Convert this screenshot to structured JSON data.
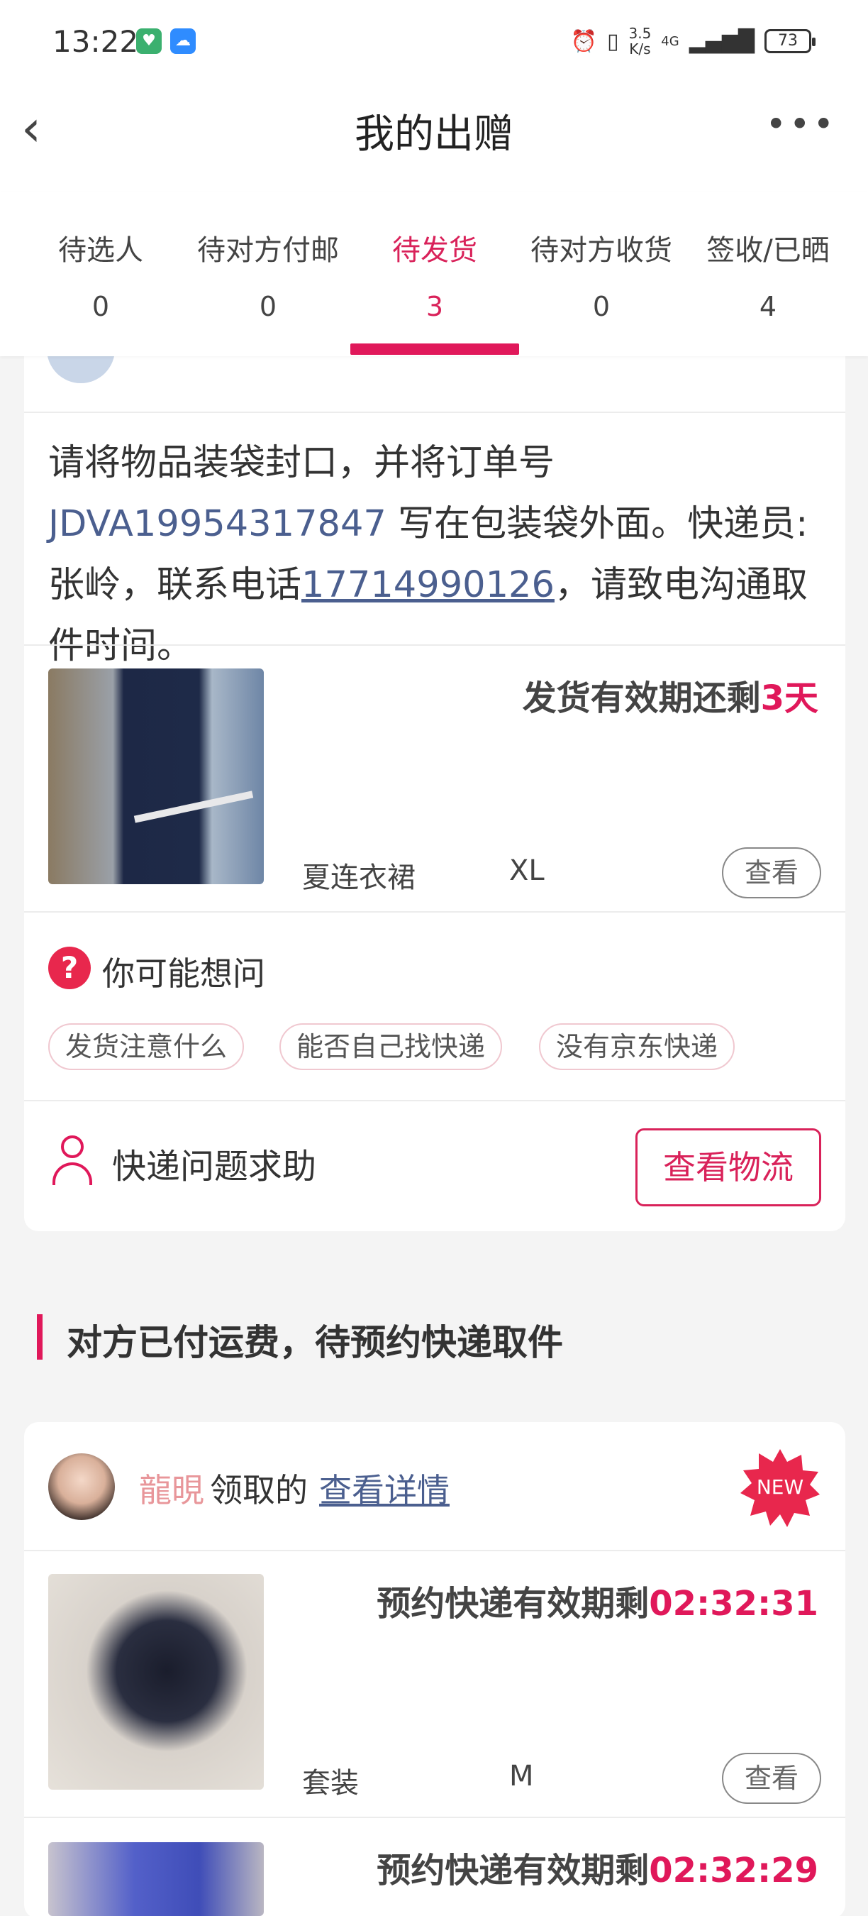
{
  "status_bar": {
    "time": "13:22",
    "speed": "3.5\nK/s",
    "network": "4G",
    "battery": "73"
  },
  "nav": {
    "back": "‹",
    "title": "我的出赠",
    "more": "•••"
  },
  "tabs": [
    {
      "label": "待选人",
      "count": "0"
    },
    {
      "label": "待对方付邮",
      "count": "0"
    },
    {
      "label": "待发货",
      "count": "3"
    },
    {
      "label": "待对方收货",
      "count": "0"
    },
    {
      "label": "签收/已晒",
      "count": "4"
    }
  ],
  "order1": {
    "notice_prefix": "请将物品装袋封口，并将订单号 ",
    "order_no": "JDVA19954317847",
    "notice_mid": " 写在包装袋外面。快递员:张岭，联系电话",
    "phone": "17714990126",
    "notice_suffix": "，请致电沟通取件时间。",
    "deadline_prefix": "发货有效期还剩",
    "deadline_value": "3天",
    "product_name": "夏连衣裙",
    "product_size": "XL",
    "view_label": "查看"
  },
  "faq": {
    "title": "你可能想问",
    "icon": "?",
    "chips": [
      "发货注意什么",
      "能否自己找快递",
      "没有京东快递"
    ]
  },
  "help": {
    "label": "快递问题求助",
    "logistics_button": "查看物流"
  },
  "section": {
    "title": "对方已付运费，待预约快递取件"
  },
  "order2": {
    "claimer": "龍晛",
    "claimed_text": "领取的",
    "detail_link": "查看详情",
    "badge": "NEW",
    "items": [
      {
        "deadline_prefix": "预约快递有效期剩",
        "deadline_value": "02:32:31",
        "name": "套装",
        "size": "M",
        "view_label": "查看"
      },
      {
        "deadline_prefix": "预约快递有效期剩",
        "deadline_value": "02:32:29"
      }
    ]
  },
  "colors": {
    "accent": "#e0185a",
    "link": "#4b5f8f"
  }
}
